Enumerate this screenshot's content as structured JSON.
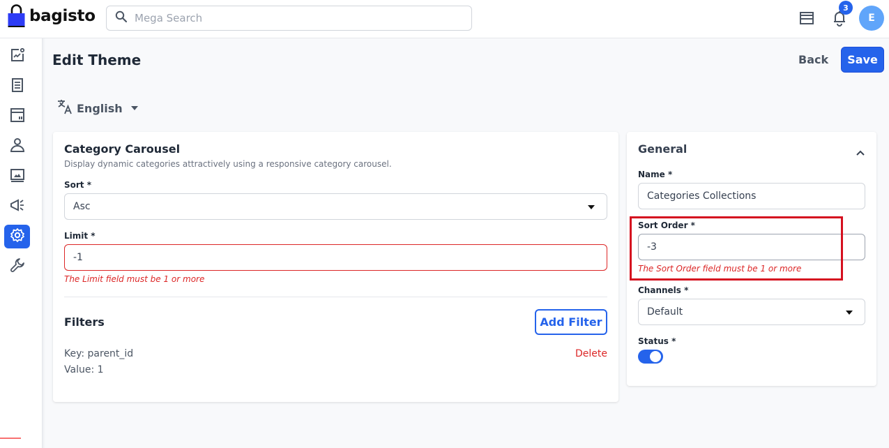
{
  "header": {
    "brand": "bagisto",
    "search_placeholder": "Mega Search",
    "notification_count": "3",
    "avatar_initial": "E"
  },
  "sidebar": {
    "items": [
      {
        "name": "dashboard",
        "icon": "chart-icon",
        "active": false
      },
      {
        "name": "sales",
        "icon": "list-icon",
        "active": false
      },
      {
        "name": "catalog",
        "icon": "layout-icon",
        "active": false
      },
      {
        "name": "customers",
        "icon": "user-icon",
        "active": false
      },
      {
        "name": "cms",
        "icon": "monitor-icon",
        "active": false
      },
      {
        "name": "marketing",
        "icon": "megaphone-icon",
        "active": false
      },
      {
        "name": "settings",
        "icon": "gear-icon",
        "active": true
      },
      {
        "name": "configure",
        "icon": "wrench-icon",
        "active": false
      }
    ]
  },
  "page": {
    "title": "Edit Theme",
    "back_label": "Back",
    "save_label": "Save",
    "locale": "English"
  },
  "carousel": {
    "title": "Category Carousel",
    "description": "Display dynamic categories attractively using a responsive category carousel.",
    "sort_label": "Sort *",
    "sort_value": "Asc",
    "limit_label": "Limit *",
    "limit_value": "-1",
    "limit_error": "The Limit field must be 1 or more",
    "filters_title": "Filters",
    "add_filter_label": "Add Filter",
    "filters": [
      {
        "key_text": "Key: parent_id",
        "value_text": "Value: 1",
        "delete_label": "Delete"
      }
    ]
  },
  "general": {
    "title": "General",
    "name_label": "Name *",
    "name_value": "Categories Collections",
    "sort_order_label": "Sort Order *",
    "sort_order_value": "-3",
    "sort_order_error": "The Sort Order field must be 1 or more",
    "channels_label": "Channels *",
    "channels_value": "Default",
    "status_label": "Status *",
    "status_on": true
  },
  "colors": {
    "primary": "#2563eb",
    "error": "#dc2626",
    "highlight": "#d5101f"
  }
}
